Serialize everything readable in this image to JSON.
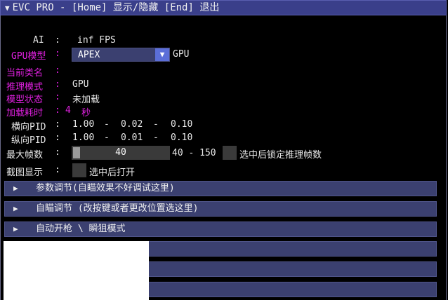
{
  "title": {
    "text": "EVC PRO - [Home] 显示/隐藏 [End] 退出"
  },
  "ai": {
    "label": "AI",
    "sep": ":",
    "value": "inf FPS"
  },
  "gpu_model": {
    "label": "GPU模型",
    "sep": ":",
    "selected": "APEX",
    "suffix": "GPU"
  },
  "current_class": {
    "label": "当前类名",
    "sep": ":"
  },
  "inference_mode": {
    "label": "推理模式",
    "sep": ":",
    "value": "GPU"
  },
  "model_status": {
    "label": "模型状态",
    "sep": ":",
    "value": "未加载"
  },
  "load_time": {
    "label": "加载耗时",
    "sep": ":",
    "value": "4",
    "unit": "秒"
  },
  "h_pid": {
    "label": "横向PID",
    "sep": ":",
    "p": "1.00",
    "i": "0.02",
    "d": "0.10",
    "dash": "-"
  },
  "v_pid": {
    "label": "纵向PID",
    "sep": ":",
    "p": "1.00",
    "i": "0.01",
    "d": "0.10",
    "dash": "-"
  },
  "max_fps": {
    "label": "最大帧数",
    "sep": ":",
    "value": "40",
    "range": "40 - 150",
    "lock_label": "选中后锁定推理帧数",
    "level": 0
  },
  "screenshot": {
    "label": "截图显示",
    "sep": ":",
    "check_label": "选中后打开"
  },
  "sections": [
    {
      "label": "参数调节(自瞄效果不好调试这里)"
    },
    {
      "label": "自瞄调节 (改按键或者更改位置选这里)"
    },
    {
      "label": "自动开枪 \\ 瞬狙模式"
    }
  ],
  "colors": {
    "accent": "#3b4070",
    "magenta": "#e020e0",
    "combo_arrow": "#5b6ed8"
  },
  "icons": {
    "collapse": "triangle-down-icon",
    "expand": "triangle-right-icon",
    "dropdown": "triangle-down-icon"
  }
}
